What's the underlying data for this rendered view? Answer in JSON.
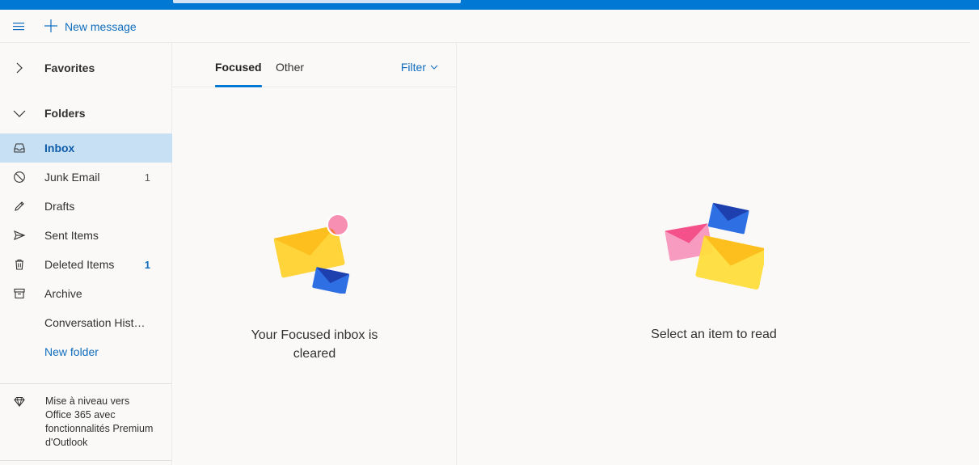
{
  "topbar": {
    "brand_color": "#0078d4"
  },
  "command_bar": {
    "menu_icon": "hamburger-icon",
    "new_message_label": "New message"
  },
  "nav": {
    "favorites_label": "Favorites",
    "folders_label": "Folders",
    "folders": [
      {
        "label": "Inbox",
        "icon": "inbox-icon",
        "count": "",
        "selected": true
      },
      {
        "label": "Junk Email",
        "icon": "blocked-icon",
        "count": "1"
      },
      {
        "label": "Drafts",
        "icon": "pencil-icon",
        "count": ""
      },
      {
        "label": "Sent Items",
        "icon": "send-icon",
        "count": ""
      },
      {
        "label": "Deleted Items",
        "icon": "trash-icon",
        "count": "1"
      },
      {
        "label": "Archive",
        "icon": "archive-icon",
        "count": ""
      },
      {
        "label": "Conversation Hist…",
        "icon": "",
        "count": ""
      }
    ],
    "new_folder_label": "New folder",
    "upsell_text": "Mise à niveau vers Office 365 avec fonctionnalités Premium d'Outlook"
  },
  "message_list": {
    "tabs": [
      "Focused",
      "Other"
    ],
    "active_tab": "Focused",
    "filter_label": "Filter",
    "empty_line1": "Your Focused inbox is",
    "empty_line2": "cleared"
  },
  "reading_pane": {
    "empty_text": "Select an item to read"
  },
  "colors": {
    "accent": "#0078d4",
    "selected_bg": "#c7e0f4",
    "link": "#0f6cbd"
  }
}
